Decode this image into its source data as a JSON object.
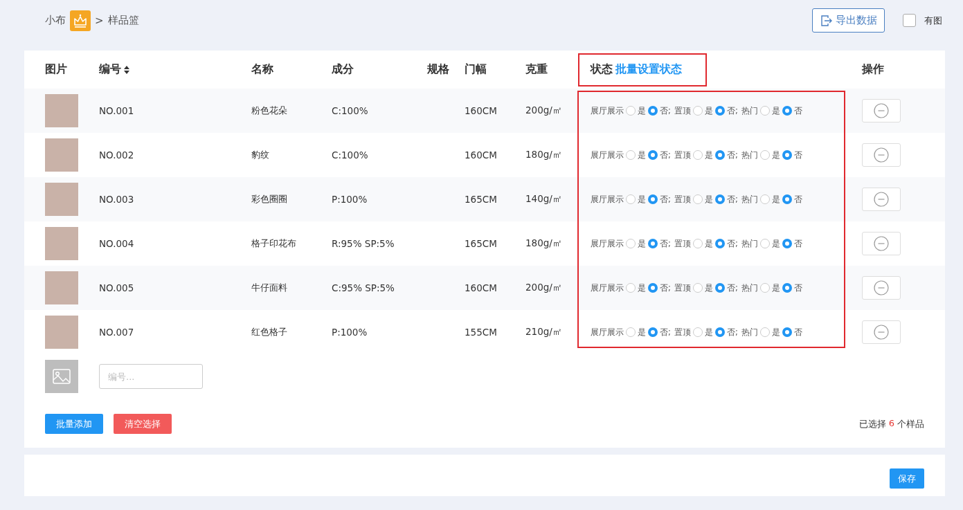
{
  "breadcrumb": {
    "user": "小布",
    "separator": ">",
    "page": "样品篮"
  },
  "toolbar": {
    "export_button": "导出数据",
    "has_image": {
      "label": "有图",
      "checked": false
    }
  },
  "table": {
    "columns": [
      {
        "label": "图片"
      },
      {
        "label": "编号",
        "sortable": true
      },
      {
        "label": "名称"
      },
      {
        "label": "成分"
      },
      {
        "label": "规格"
      },
      {
        "label": "门幅"
      },
      {
        "label": "克重"
      },
      {
        "label": "状态",
        "link": "批量设置状态",
        "highlighted": true
      },
      {
        "label": "操作"
      }
    ],
    "status_highlighted": true,
    "rows": [
      {
        "code": "NO.001",
        "name": "粉色花朵",
        "composition": "C:100%",
        "width": "160CM",
        "weight": "200g/㎡",
        "status": [
          {
            "label": "展厅展示",
            "yes": "是",
            "no": "否",
            "yes_selected": false,
            "separator": ";"
          },
          {
            "label": "置顶",
            "yes": "是",
            "no": "否",
            "yes_selected": false,
            "separator": ";"
          },
          {
            "label": "热门",
            "yes": "是",
            "no": "否",
            "yes_selected": false
          }
        ]
      },
      {
        "code": "NO.002",
        "name": "豹纹",
        "composition": "C:100%",
        "width": "160CM",
        "weight": "180g/㎡",
        "status": [
          {
            "label": "展厅展示",
            "yes": "是",
            "no": "否",
            "yes_selected": false,
            "separator": ";"
          },
          {
            "label": "置顶",
            "yes": "是",
            "no": "否",
            "yes_selected": false,
            "separator": ";"
          },
          {
            "label": "热门",
            "yes": "是",
            "no": "否",
            "yes_selected": false
          }
        ]
      },
      {
        "code": "NO.003",
        "name": "彩色圈圈",
        "composition": "P:100%",
        "width": "165CM",
        "weight": "140g/㎡",
        "status": [
          {
            "label": "展厅展示",
            "yes": "是",
            "no": "否",
            "yes_selected": false,
            "separator": ";"
          },
          {
            "label": "置顶",
            "yes": "是",
            "no": "否",
            "yes_selected": false,
            "separator": ";"
          },
          {
            "label": "热门",
            "yes": "是",
            "no": "否",
            "yes_selected": false
          }
        ]
      },
      {
        "code": "NO.004",
        "name": "格子印花布",
        "composition": "R:95% SP:5%",
        "width": "165CM",
        "weight": "180g/㎡",
        "status": [
          {
            "label": "展厅展示",
            "yes": "是",
            "no": "否",
            "yes_selected": false,
            "separator": ";"
          },
          {
            "label": "置顶",
            "yes": "是",
            "no": "否",
            "yes_selected": false,
            "separator": ";"
          },
          {
            "label": "热门",
            "yes": "是",
            "no": "否",
            "yes_selected": false
          }
        ]
      },
      {
        "code": "NO.005",
        "name": "牛仔面料",
        "composition": "C:95% SP:5%",
        "width": "160CM",
        "weight": "200g/㎡",
        "status": [
          {
            "label": "展厅展示",
            "yes": "是",
            "no": "否",
            "yes_selected": false,
            "separator": ";"
          },
          {
            "label": "置顶",
            "yes": "是",
            "no": "否",
            "yes_selected": false,
            "separator": ";"
          },
          {
            "label": "热门",
            "yes": "是",
            "no": "否",
            "yes_selected": false
          }
        ]
      },
      {
        "code": "NO.007",
        "name": "红色格子",
        "composition": "P:100%",
        "width": "155CM",
        "weight": "210g/㎡",
        "status": [
          {
            "label": "展厅展示",
            "yes": "是",
            "no": "否",
            "yes_selected": false,
            "separator": ";"
          },
          {
            "label": "置顶",
            "yes": "是",
            "no": "否",
            "yes_selected": false,
            "separator": ";"
          },
          {
            "label": "热门",
            "yes": "是",
            "no": "否",
            "yes_selected": false
          }
        ]
      }
    ],
    "add_row": {
      "placeholder": "编号..."
    }
  },
  "actions": {
    "batch_add": "批量添加",
    "clear_selection": "清空选择",
    "selected_prefix": "已选择",
    "selected_count": "6",
    "selected_suffix": "个样品"
  },
  "footer": {
    "save_button": "保存"
  }
}
